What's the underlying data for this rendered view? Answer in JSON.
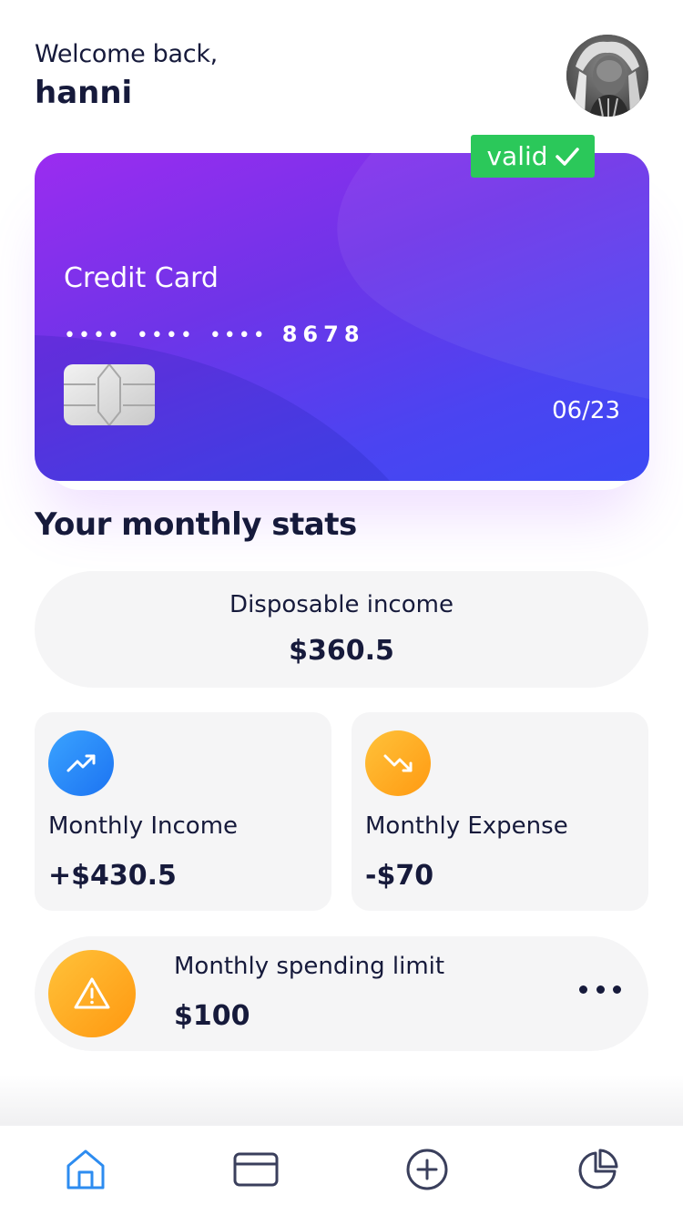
{
  "header": {
    "greeting": "Welcome back,",
    "username": "hanni"
  },
  "card": {
    "type_label": "Credit Card",
    "masked_groups": [
      "••••",
      "••••",
      "••••"
    ],
    "last4": "8678",
    "expiry": "06/23",
    "status": "valid",
    "status_color": "#2bc85a",
    "gradient": [
      "#9b2cf0",
      "#3c4af5"
    ]
  },
  "stats": {
    "section_title": "Your monthly stats",
    "disposable": {
      "label": "Disposable income",
      "value": "$360.5"
    },
    "income": {
      "label": "Monthly Income",
      "value": "+$430.5",
      "icon": "trending-up-icon"
    },
    "expense": {
      "label": "Monthly Expense",
      "value": "-$70",
      "icon": "trending-down-icon"
    },
    "limit": {
      "label": "Monthly spending limit",
      "value": "$100",
      "icon": "warning-icon"
    }
  },
  "nav": {
    "active": "home",
    "items": [
      "home-icon",
      "credit-card-icon",
      "add-circle-icon",
      "pie-chart-icon"
    ],
    "active_color": "#2d8cf0",
    "icon_color": "#3a3f5c"
  }
}
